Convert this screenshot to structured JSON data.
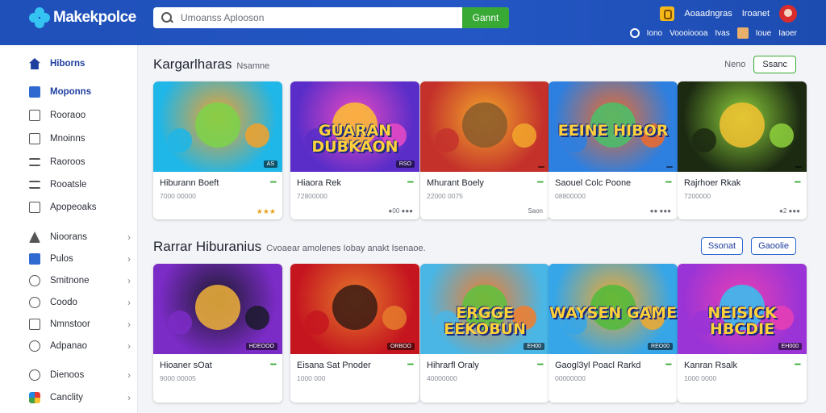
{
  "header": {
    "logo_text": "Makekpolce",
    "search_placeholder": "Umoanss Aplooson",
    "search_button": "Gannt",
    "top_links": [
      "Aoaadngras",
      "Iroanet"
    ],
    "bottom_links": [
      "Iono",
      "Voooioooa",
      "Ivas",
      "Ioue",
      "Iaoer"
    ],
    "colors": {
      "bar": "#2457c5",
      "search_button": "#39a935"
    }
  },
  "sidebar": {
    "items": [
      {
        "label": "Hiborns",
        "icon": "home-icon",
        "chevron": false
      },
      {
        "label": "Moponns",
        "icon": "checkbox-icon",
        "chevron": false
      },
      {
        "label": "Rooraoo",
        "icon": "box-icon",
        "chevron": false
      },
      {
        "label": "Mnoinns",
        "icon": "box-icon",
        "chevron": false
      },
      {
        "label": "Raoroos",
        "icon": "list-icon",
        "chevron": false
      },
      {
        "label": "Rooatsle",
        "icon": "list-icon",
        "chevron": false
      },
      {
        "label": "Apopeoaks",
        "icon": "box-icon",
        "chevron": false
      },
      {
        "label": "Nioorans",
        "icon": "triangle-icon",
        "chevron": true
      },
      {
        "label": "Pulos",
        "icon": "checkbox-icon",
        "chevron": true
      },
      {
        "label": "Smitnone",
        "icon": "circle-icon",
        "chevron": true
      },
      {
        "label": "Coodo",
        "icon": "circle-icon",
        "chevron": true
      },
      {
        "label": "Nmnstoor",
        "icon": "box-icon",
        "chevron": true
      },
      {
        "label": "Adpanao",
        "icon": "circle-icon",
        "chevron": true
      },
      {
        "label": "Dienoos",
        "icon": "circle-icon",
        "chevron": true
      },
      {
        "label": "Canclity",
        "icon": "colors-icon",
        "chevron": true
      }
    ]
  },
  "sections": [
    {
      "title": "Kargarlharas",
      "subtitle": "Nsamne",
      "right_link": "Neno",
      "right_button": "Ssanc",
      "cards": [
        {
          "name": "Hiburann Boeft",
          "meta": "7000 00000",
          "foot": "★★★",
          "tag": "AS",
          "thumb_text": "",
          "colors": [
            "#1fb6e8",
            "#f3a12a",
            "#7bd34a"
          ],
          "rating": "•••••"
        },
        {
          "name": "Hiaora Rek",
          "meta": "72800000",
          "foot": "●00 ●●●",
          "tag": "RSO",
          "thumb_text": "GUARAN DUBKAON",
          "colors": [
            "#5a2dc8",
            "#e94ac4",
            "#ffbf2e"
          ],
          "rating": "•••••"
        },
        {
          "name": "Mhurant Boely",
          "meta": "22000 0075",
          "foot": "Saon",
          "tag": "",
          "thumb_text": "",
          "colors": [
            "#c4312b",
            "#f2a72b",
            "#8a5b2c"
          ],
          "rating": "•••••"
        },
        {
          "name": "Saouel Colc Poone",
          "meta": "08800000",
          "foot": "●● ●●●",
          "tag": "",
          "thumb_text": "EEINE HIBOR",
          "colors": [
            "#2d7fe0",
            "#f06a2a",
            "#47c26a"
          ],
          "rating": "•••••"
        },
        {
          "name": "Rajrhoer Rkak",
          "meta": "7200000",
          "foot": "●2 ●●●",
          "tag": "",
          "thumb_text": "",
          "colors": [
            "#1c2a12",
            "#8ed13c",
            "#f2c231"
          ],
          "rating": "•••••"
        }
      ]
    },
    {
      "title": "Rarrar Hiburanius",
      "subtitle": "Cvoaear amolenes Iobay anakt Isenaoe.",
      "right_buttons": [
        "Ssonat",
        "Gaoolie"
      ],
      "cards": [
        {
          "name": "Hioaner sOat",
          "meta": "9000 00005",
          "tag": "HDEOOO",
          "thumb_text": "",
          "colors": [
            "#7b2bc6",
            "#1a1a2a",
            "#f0b23a"
          ],
          "rating": "•••••"
        },
        {
          "name": "Eisana Sat Pnoder",
          "meta": "1000 000",
          "tag": "ORBOO",
          "thumb_text": "",
          "colors": [
            "#c5161f",
            "#e57a2b",
            "#3a1b14"
          ],
          "rating": "•••••"
        },
        {
          "name": "Hihrarfl Oraly",
          "meta": "40000000",
          "tag": "EH00",
          "thumb_text": "ERGGE EEKOBUN",
          "colors": [
            "#49b6e6",
            "#f27c2b",
            "#5cc23e"
          ],
          "rating": "•••••"
        },
        {
          "name": "Gaogl3yl Poacl Rarkd",
          "meta": "00000000",
          "tag": "REO00",
          "thumb_text": "WAYSEN GAME",
          "colors": [
            "#36a6e8",
            "#f2a92b",
            "#4fbb3a"
          ],
          "rating": "•••••"
        },
        {
          "name": "Kanran Rsalk",
          "meta": "1000 0000",
          "tag": "EH000",
          "thumb_text": "NEISICK HBCDIE",
          "colors": [
            "#9a34d6",
            "#e73fb4",
            "#33c3f0"
          ],
          "rating": "•••••"
        }
      ]
    }
  ]
}
